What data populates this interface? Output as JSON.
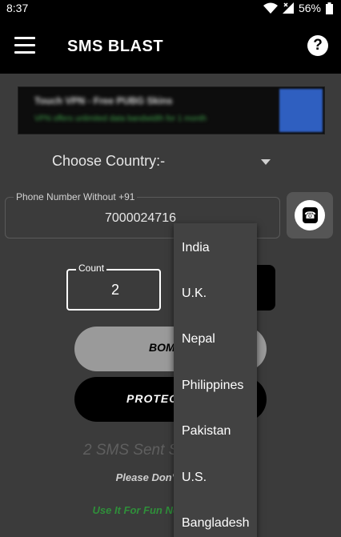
{
  "status_bar": {
    "time": "8:37",
    "battery": "56%"
  },
  "app_bar": {
    "title": "SMS BLAST"
  },
  "ad": {
    "title": "Touch VPN - Free PUBG Skins",
    "subtitle": "VPN offers unlimited data bandwidth for 1 month"
  },
  "form": {
    "country_label": "Choose Country:-",
    "phone_label": "Phone Number Without +91",
    "phone_value": "7000024716",
    "count_label": "Count",
    "count_value": "2"
  },
  "buttons": {
    "bomb": "BOMB",
    "protect": "PROTECT"
  },
  "status_text": "2 SMS Sent S",
  "notes": {
    "misuse": "Please Don't Misuse It",
    "revenge": "Use It For Fun Not For Revenge"
  },
  "dropdown": {
    "options": [
      "India",
      "U.K.",
      "Nepal",
      "Philippines",
      "Pakistan",
      "U.S.",
      "Bangladesh"
    ]
  },
  "colors": {
    "accent_green": "#2f8f3a",
    "appbar": "#000000",
    "background": "#3b3b3b"
  }
}
